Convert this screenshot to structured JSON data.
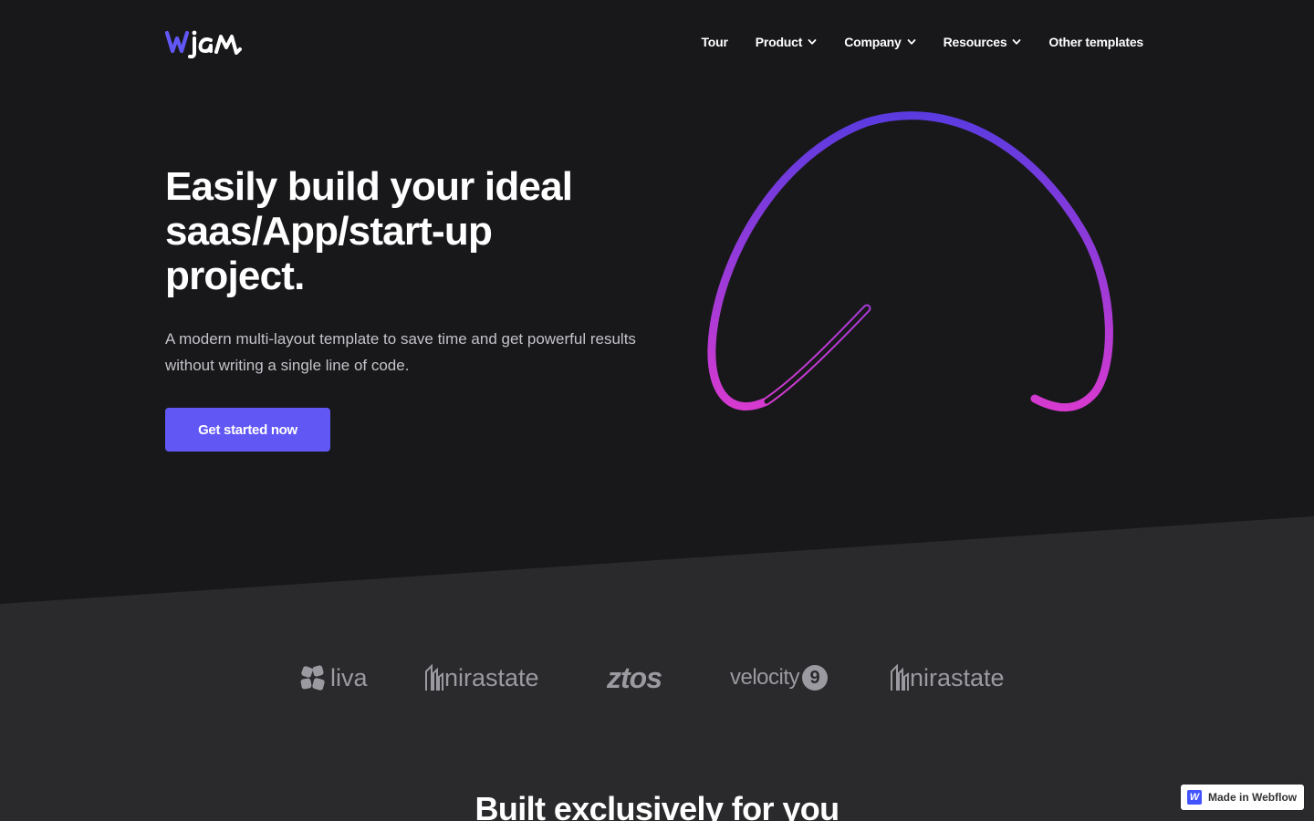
{
  "colors": {
    "background": "#18181b",
    "band": "#2a2a2c",
    "accent": "#6157f5",
    "logo_gray": "#9a9aa0",
    "swirl_start": "#5b3be0",
    "swirl_end": "#d63ad0"
  },
  "header": {
    "logo_text": "wjam",
    "nav": [
      {
        "label": "Tour",
        "has_dropdown": false
      },
      {
        "label": "Product",
        "has_dropdown": true
      },
      {
        "label": "Company",
        "has_dropdown": true
      },
      {
        "label": "Resources",
        "has_dropdown": true
      },
      {
        "label": "Other templates",
        "has_dropdown": false
      }
    ]
  },
  "hero": {
    "title": "Easily build your ideal saas/App/start-up project.",
    "subtitle": "A modern multi-layout template to save time and get powerful results without writing a single line of code.",
    "cta_label": "Get started now"
  },
  "logos": {
    "liva": "liva",
    "nirastate_1": "nirastate",
    "ztos": "ztos",
    "velocity": "velocity",
    "velocity_badge": "9",
    "nirastate_2": "nirastate"
  },
  "section": {
    "title": "Built exclusively for you"
  },
  "badge": {
    "icon_letter": "W",
    "label": "Made in Webflow"
  }
}
